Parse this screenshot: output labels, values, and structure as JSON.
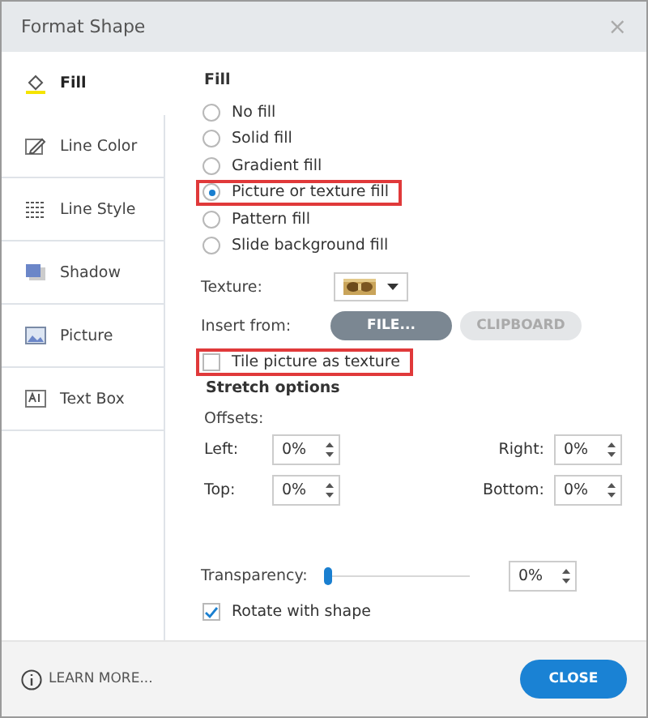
{
  "window": {
    "title": "Format Shape",
    "close": "×"
  },
  "sidebar": {
    "items": [
      {
        "label": "Fill",
        "selected": true
      },
      {
        "label": "Line Color",
        "selected": false
      },
      {
        "label": "Line Style",
        "selected": false
      },
      {
        "label": "Shadow",
        "selected": false
      },
      {
        "label": "Picture",
        "selected": false
      },
      {
        "label": "Text Box",
        "selected": false
      }
    ]
  },
  "fill": {
    "heading": "Fill",
    "options": [
      {
        "label": "No fill",
        "selected": false,
        "highlighted": false
      },
      {
        "label": "Solid fill",
        "selected": false,
        "highlighted": false
      },
      {
        "label": "Gradient fill",
        "selected": false,
        "highlighted": false
      },
      {
        "label": "Picture or texture fill",
        "selected": true,
        "highlighted": true
      },
      {
        "label": "Pattern fill",
        "selected": false,
        "highlighted": false
      },
      {
        "label": "Slide background fill",
        "selected": false,
        "highlighted": false
      }
    ],
    "texture_label": "Texture:",
    "insert_label": "Insert from:",
    "insert_buttons": [
      {
        "label": "FILE...",
        "disabled": false
      },
      {
        "label": "CLIPBOARD",
        "disabled": true
      }
    ],
    "tile": {
      "label": "Tile picture as texture",
      "checked": false,
      "highlighted": true
    },
    "stretch_heading": "Stretch options",
    "offsets_label": "Offsets:",
    "offsets": [
      {
        "label": "Left:",
        "value": "0%"
      },
      {
        "label": "Right:",
        "value": "0%"
      },
      {
        "label": "Top:",
        "value": "0%"
      },
      {
        "label": "Bottom:",
        "value": "0%"
      }
    ],
    "transparency": {
      "label": "Transparency:",
      "level": 0,
      "value": "0%"
    },
    "rotate": {
      "label": "Rotate with shape",
      "checked": true
    }
  },
  "footer": {
    "learn_more": "LEARN MORE...",
    "close": "CLOSE"
  }
}
